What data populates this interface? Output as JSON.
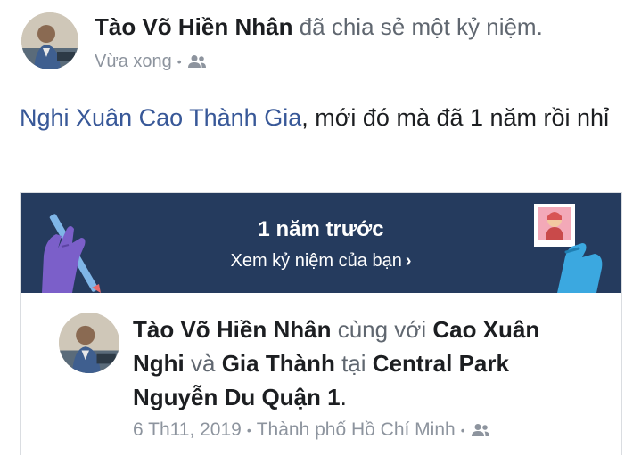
{
  "post": {
    "author": "Tào Võ Hiền Nhân",
    "action": "đã chia sẻ một kỷ niệm.",
    "time": "Vừa xong",
    "separator": "•",
    "audience_icon": "friends-icon",
    "caption_mention": "Nghi Xuân Cao Thành Gia",
    "caption_text": ", mới đó mà đã 1 năm rồi nhỉ"
  },
  "memory": {
    "title": "1 năm trước",
    "link_label": "Xem kỷ niệm của bạn",
    "link_icon": "chevron-right-icon",
    "colors": {
      "banner": "#253b5e",
      "hand_left": "#7b5fc9",
      "hand_right": "#3ba8e0"
    }
  },
  "shared_post": {
    "author": "Tào Võ Hiền Nhân",
    "with_word": "cùng với",
    "friend1": "Cao Xuân Nghi",
    "and_word": "và",
    "friend2": "Gia Thành",
    "at_word": "tại",
    "place": "Central Park Nguyễn Du Quận 1",
    "period": ".",
    "date": "6 Th11, 2019",
    "separator1": "•",
    "location": "Thành phố Hồ Chí Minh",
    "separator2": "•",
    "audience_icon": "friends-icon"
  }
}
